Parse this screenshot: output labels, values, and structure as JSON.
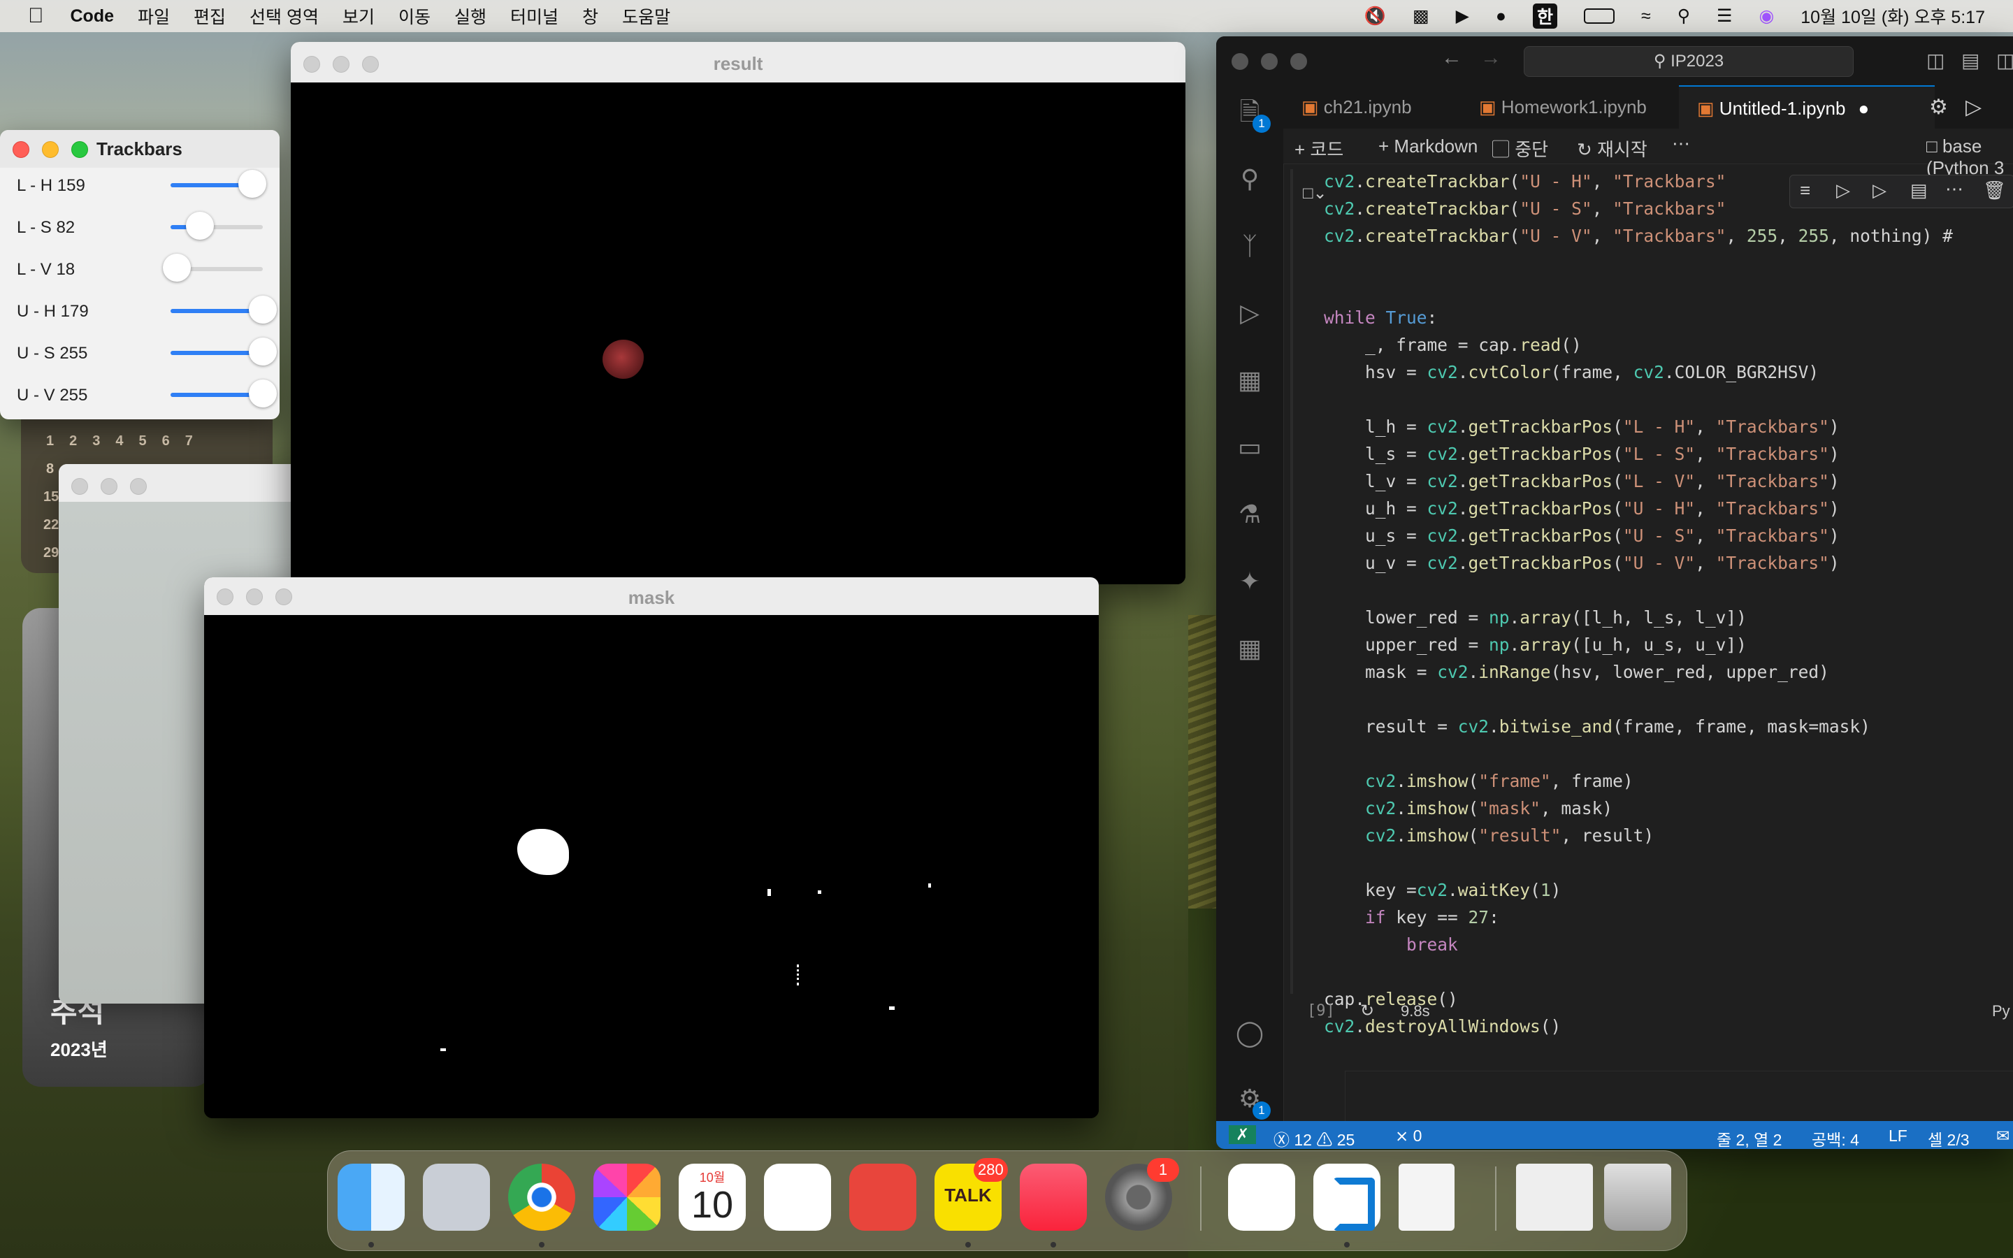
{
  "menubar": {
    "app": "Code",
    "items": [
      "파일",
      "편집",
      "선택 영역",
      "보기",
      "이동",
      "실행",
      "터미널",
      "창",
      "도움말"
    ],
    "input_source": "한",
    "clock": "10월 10일 (화) 오후 5:17"
  },
  "trackbars": {
    "title": "Trackbars",
    "rows": [
      {
        "label": "L - H 159",
        "value": 159,
        "max": 179
      },
      {
        "label": "L - S 82",
        "value": 82,
        "max": 255
      },
      {
        "label": "L - V 18",
        "value": 18,
        "max": 255
      },
      {
        "label": "U - H 179",
        "value": 179,
        "max": 179
      },
      {
        "label": "U - S 255",
        "value": 255,
        "max": 255
      },
      {
        "label": "U - V 255",
        "value": 255,
        "max": 255
      }
    ]
  },
  "calendar_widget": {
    "rows": [
      [
        "1",
        "2",
        "3",
        "4",
        "5",
        "6",
        "7"
      ],
      [
        "8"
      ],
      [
        "15"
      ],
      [
        "22"
      ],
      [
        "29"
      ]
    ]
  },
  "photo_widget": {
    "title": "추석",
    "year": "2023년"
  },
  "result_window": {
    "title": "result"
  },
  "mask_window": {
    "title": "mask"
  },
  "vscode": {
    "search": "IP2023",
    "tabs": [
      "ch21.ipynb",
      "Homework1.ipynb",
      "Untitled-1.ipynb"
    ],
    "toolbar": {
      "code": "코드",
      "markdown": "Markdown",
      "interrupt": "중단",
      "restart": "재시작",
      "kernel": "base (Python 3"
    },
    "code_lines": [
      "cv2.createTrackbar(\"U - H\", \"Trackbars\"",
      "cv2.createTrackbar(\"U - S\", \"Trackbars\"",
      "cv2.createTrackbar(\"U - V\", \"Trackbars\", 255, 255, nothing) #",
      "",
      "",
      "while True:",
      "    _, frame = cap.read()",
      "    hsv = cv2.cvtColor(frame, cv2.COLOR_BGR2HSV)",
      "",
      "    l_h = cv2.getTrackbarPos(\"L - H\", \"Trackbars\")",
      "    l_s = cv2.getTrackbarPos(\"L - S\", \"Trackbars\")",
      "    l_v = cv2.getTrackbarPos(\"L - V\", \"Trackbars\")",
      "    u_h = cv2.getTrackbarPos(\"U - H\", \"Trackbars\")",
      "    u_s = cv2.getTrackbarPos(\"U - S\", \"Trackbars\")",
      "    u_v = cv2.getTrackbarPos(\"U - V\", \"Trackbars\")",
      "",
      "    lower_red = np.array([l_h, l_s, l_v])",
      "    upper_red = np.array([u_h, u_s, u_v])",
      "    mask = cv2.inRange(hsv, lower_red, upper_red)",
      "",
      "    result = cv2.bitwise_and(frame, frame, mask=mask)",
      "",
      "    cv2.imshow(\"frame\", frame)",
      "    cv2.imshow(\"mask\", mask)",
      "    cv2.imshow(\"result\", result)",
      "",
      "    key =cv2.waitKey(1)",
      "    if key == 27:",
      "        break",
      "",
      "cap.release()",
      "cv2.destroyAllWindows()"
    ],
    "exec_count": "[9]",
    "exec_time": "9.8s",
    "lang": "Py",
    "activity_badges": {
      "explorer": "1",
      "settings": "1"
    },
    "status": {
      "errors": "12",
      "warnings": "25",
      "ports": "0",
      "position": "줄 2, 열 2",
      "spaces": "공백: 4",
      "eol": "LF",
      "cell": "셀 2/3"
    }
  },
  "dock": {
    "calendar_month": "10월",
    "calendar_day": "10",
    "kakao_label": "TALK",
    "kakao_badge": "280",
    "settings_badge": "1"
  }
}
